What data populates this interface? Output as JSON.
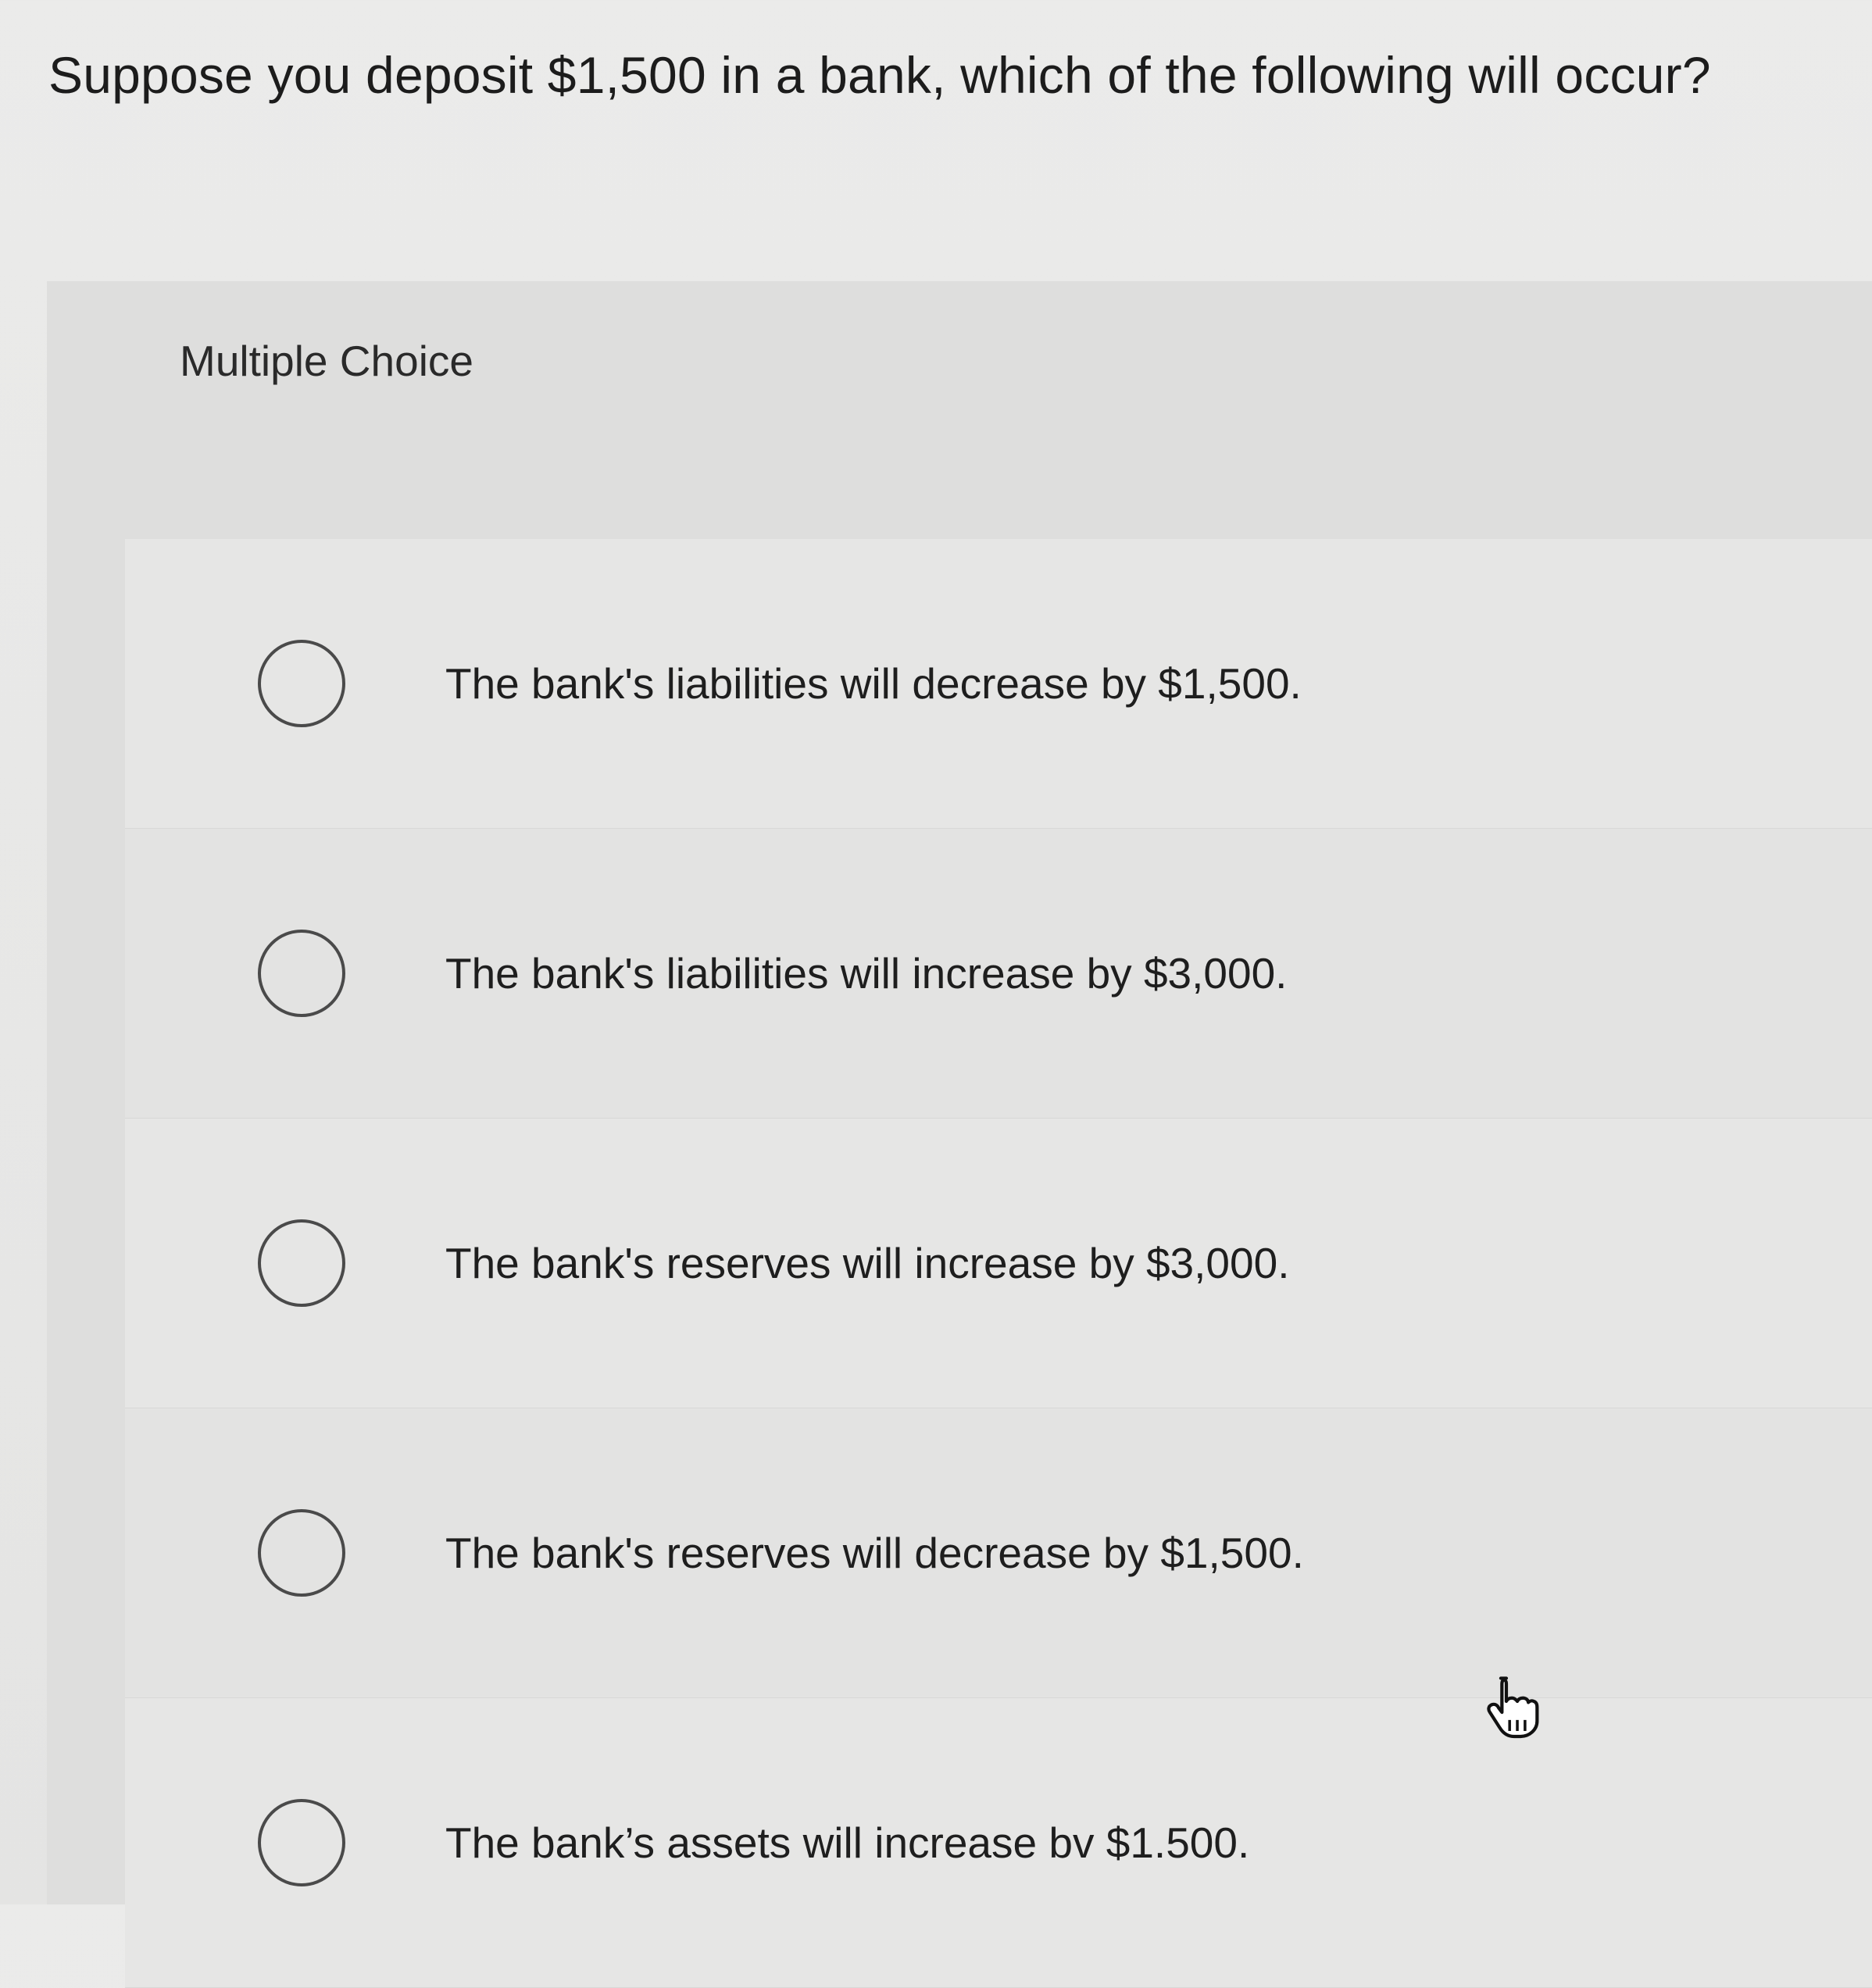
{
  "question": "Suppose you deposit $1,500 in a bank, which of the following will occur?",
  "section_label": "Multiple Choice",
  "options": [
    {
      "label": "The bank's liabilities will decrease by $1,500."
    },
    {
      "label": "The bank's liabilities will increase by $3,000."
    },
    {
      "label": "The bank's reserves will increase by $3,000."
    },
    {
      "label": "The bank's reserves will decrease by $1,500."
    },
    {
      "label": "The bank’s assets will increase bv $1.500."
    }
  ],
  "icons": {
    "radio": "radio-button-icon",
    "cursor": "hand-pointer-icon"
  }
}
